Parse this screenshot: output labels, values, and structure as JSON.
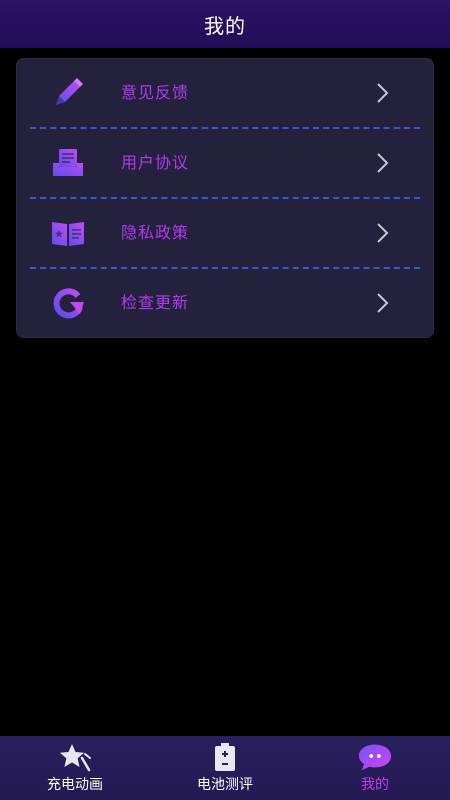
{
  "header": {
    "title": "我的"
  },
  "menu": {
    "items": [
      {
        "label": "意见反馈",
        "icon": "pencil-icon"
      },
      {
        "label": "用户协议",
        "icon": "document-tray-icon"
      },
      {
        "label": "隐私政策",
        "icon": "open-book-icon"
      },
      {
        "label": "检查更新",
        "icon": "refresh-icon"
      }
    ]
  },
  "tabbar": {
    "tabs": [
      {
        "label": "充电动画",
        "icon": "star-icon",
        "active": false
      },
      {
        "label": "电池测评",
        "icon": "battery-icon",
        "active": false
      },
      {
        "label": "我的",
        "icon": "chat-bubble-icon",
        "active": true
      }
    ]
  },
  "colors": {
    "accent": "#b03bf2",
    "icon_gradient_start": "#5b4ee8",
    "icon_gradient_end": "#c04bf5",
    "header_bg": "#2a1466",
    "card_bg": "#23213b",
    "divider": "#3a59c9",
    "tabbar_bg": "#2a1f5e"
  }
}
